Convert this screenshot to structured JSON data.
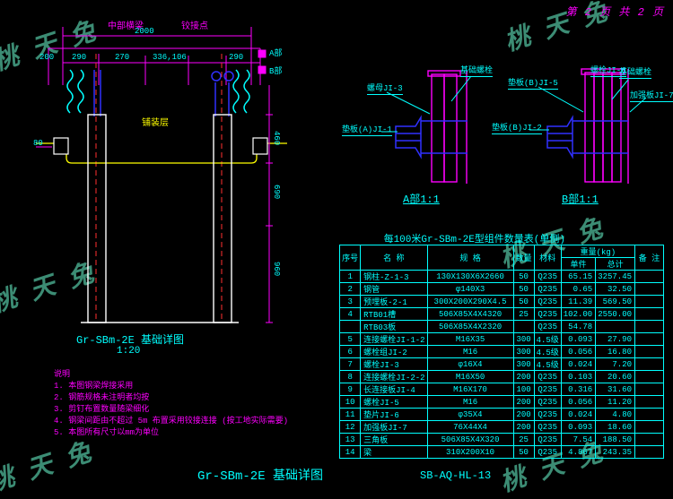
{
  "page_no": "第 2 页 共 2 页",
  "footer_title": "Gr-SBm-2E 基础详图",
  "drawing_no": "SB-AQ-HL-13",
  "watermark_text": "桃 天 兔",
  "main_view": {
    "title": "Gr-SBm-2E 基础详图",
    "scale": "1:20",
    "dim_top_total": "2000",
    "dim_top_a": "290",
    "dim_top_b": "270",
    "dim_top_c": "336,106",
    "dim_top_d": "290",
    "dim_top_left": "200",
    "dim_side_a": "460",
    "dim_side_b": "690",
    "dim_side_c": "960",
    "dim_h1": "80",
    "label_A": "A部",
    "label_B": "B部",
    "label_wave": "铺装层",
    "top_note_a": "中部横梁",
    "top_note_b": "铰接点"
  },
  "detail_A": {
    "title": "A部1:1",
    "l1": "螺母JI-3",
    "l2": "基础螺栓",
    "l3": "垫板(A)JI-1"
  },
  "detail_B": {
    "title": "B部1:1",
    "l1": "垫板(B)JI-5",
    "l2": "螺栓JI-6",
    "l3": "垫板(B)JI-2",
    "l4": "基础螺栓",
    "l5": "加强板JI-7"
  },
  "notes": {
    "head": "说明",
    "n1": "1. 本图钢梁焊接采用",
    "n2": "2. 钢筋规格未注明者均按",
    "n3": "3. 剪钉布置数量随梁细化",
    "n4": "4. 钢梁间距由不超过 5m 布置采用铰接连接 (按工地实际需要)",
    "n5": "5. 本图所有尺寸以mm为单位"
  },
  "bom": {
    "title": "每100米Gr-SBm-2E型组件数量表(单侧)",
    "headers": {
      "seq": "序号",
      "name": "名 称",
      "spec": "规 格",
      "qty": "数量",
      "mat": "材料",
      "wgrp": "重量(kg)",
      "w_each": "单件",
      "w_total": "总计",
      "note": "备 注"
    },
    "rows": [
      {
        "seq": "1",
        "name": "钢柱-Z-1-3",
        "spec": "130X130X6X2660",
        "qty": "50",
        "mat": "Q235",
        "we": "65.15",
        "wt": "3257.45",
        "note": ""
      },
      {
        "seq": "2",
        "name": "钢管",
        "spec": "φ140X3",
        "qty": "50",
        "mat": "Q235",
        "we": "0.65",
        "wt": "32.50",
        "note": ""
      },
      {
        "seq": "3",
        "name": "预埋板-2-1",
        "spec": "300X200X290X4.5",
        "qty": "50",
        "mat": "Q235",
        "we": "11.39",
        "wt": "569.50",
        "note": ""
      },
      {
        "seq": "4",
        "name": "RTB01槽",
        "spec": "506X85X4X4320",
        "qty": "25",
        "mat": "Q235",
        "we": "102.00",
        "wt": "2550.00",
        "note": ""
      },
      {
        "seq": "",
        "name": "RTB03板",
        "spec": "506X85X4X2320",
        "qty": "",
        "mat": "Q235",
        "we": "54.78",
        "wt": "",
        "note": ""
      },
      {
        "seq": "5",
        "name": "连接螺栓JI-1-2",
        "spec": "M16X35",
        "qty": "300",
        "mat": "4.5级",
        "we": "0.093",
        "wt": "27.90",
        "note": ""
      },
      {
        "seq": "6",
        "name": "螺栓组JI-2",
        "spec": "M16",
        "qty": "300",
        "mat": "4.5级",
        "we": "0.056",
        "wt": "16.80",
        "note": ""
      },
      {
        "seq": "7",
        "name": "螺栓JI-3",
        "spec": "φ16X4",
        "qty": "300",
        "mat": "4.5级",
        "we": "0.024",
        "wt": "7.20",
        "note": ""
      },
      {
        "seq": "8",
        "name": "连接螺栓JI-2-2",
        "spec": "M16X50",
        "qty": "200",
        "mat": "Q235",
        "we": "0.103",
        "wt": "20.60",
        "note": ""
      },
      {
        "seq": "9",
        "name": "长连接板JI-4",
        "spec": "M16X170",
        "qty": "100",
        "mat": "Q235",
        "we": "0.316",
        "wt": "31.60",
        "note": ""
      },
      {
        "seq": "10",
        "name": "螺栓JI-5",
        "spec": "M16",
        "qty": "200",
        "mat": "Q235",
        "we": "0.056",
        "wt": "11.20",
        "note": ""
      },
      {
        "seq": "11",
        "name": "垫片JI-6",
        "spec": "φ35X4",
        "qty": "200",
        "mat": "Q235",
        "we": "0.024",
        "wt": "4.80",
        "note": ""
      },
      {
        "seq": "12",
        "name": "加强板JI-7",
        "spec": "76X44X4",
        "qty": "200",
        "mat": "Q235",
        "we": "0.093",
        "wt": "18.60",
        "note": ""
      },
      {
        "seq": "13",
        "name": "三角板",
        "spec": "506X85X4X320",
        "qty": "25",
        "mat": "Q235",
        "we": "7.54",
        "wt": "188.50",
        "note": ""
      },
      {
        "seq": "14",
        "name": "梁",
        "spec": "310X200X10",
        "qty": "50",
        "mat": "Q235",
        "we": "4.867",
        "wt": "243.35",
        "note": ""
      }
    ]
  }
}
